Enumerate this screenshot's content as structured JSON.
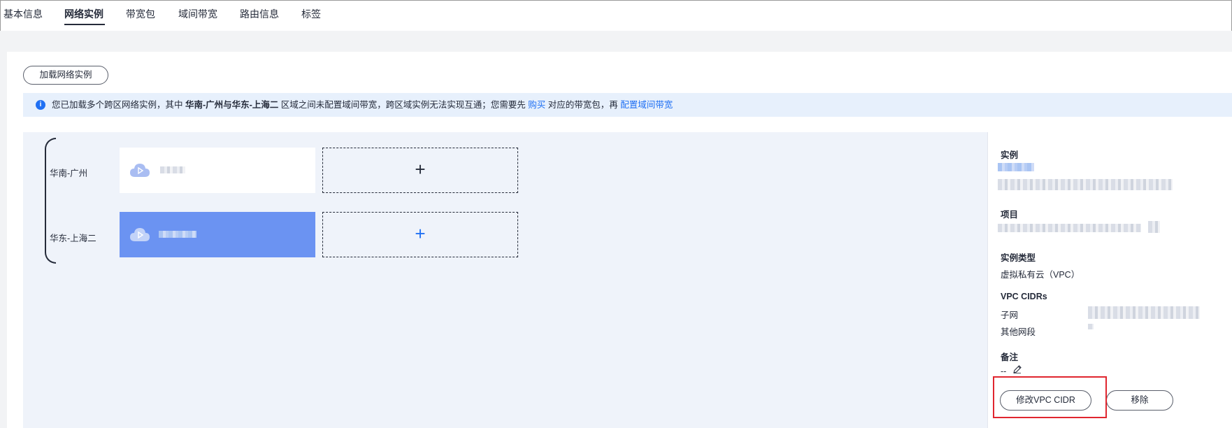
{
  "tabs": [
    {
      "label": "基本信息",
      "active": false
    },
    {
      "label": "网络实例",
      "active": true
    },
    {
      "label": "带宽包",
      "active": false
    },
    {
      "label": "域间带宽",
      "active": false
    },
    {
      "label": "路由信息",
      "active": false
    },
    {
      "label": "标签",
      "active": false
    }
  ],
  "toolbar": {
    "load_instance_label": "加载网络实例"
  },
  "alert": {
    "prefix": "您已加载多个跨区网络实例，其中 ",
    "regions_bold": "华南-广州与华东-上海二",
    "middle": " 区域之间未配置域间带宽，跨区域实例无法实现互通；您需要先",
    "buy_link": "购买",
    "after_buy": "对应的带宽包，再",
    "config_link": "配置域间带宽"
  },
  "regions": [
    {
      "label": "华南-广州",
      "add_symbol": "+"
    },
    {
      "label": "华东-上海二",
      "add_symbol": "+"
    }
  ],
  "detail": {
    "instance_label": "实例",
    "project_label": "项目",
    "type_label": "实例类型",
    "type_value": "虚拟私有云（VPC）",
    "cidrs_label": "VPC CIDRs",
    "subnet_label": "子网",
    "other_label": "其他网段",
    "remark_label": "备注",
    "remark_value": "--",
    "modify_button": "修改VPC CIDR",
    "remove_button": "移除"
  },
  "colors": {
    "accent": "#2070f3",
    "selected_card": "#6b93f2",
    "highlight": "#e0262f"
  }
}
